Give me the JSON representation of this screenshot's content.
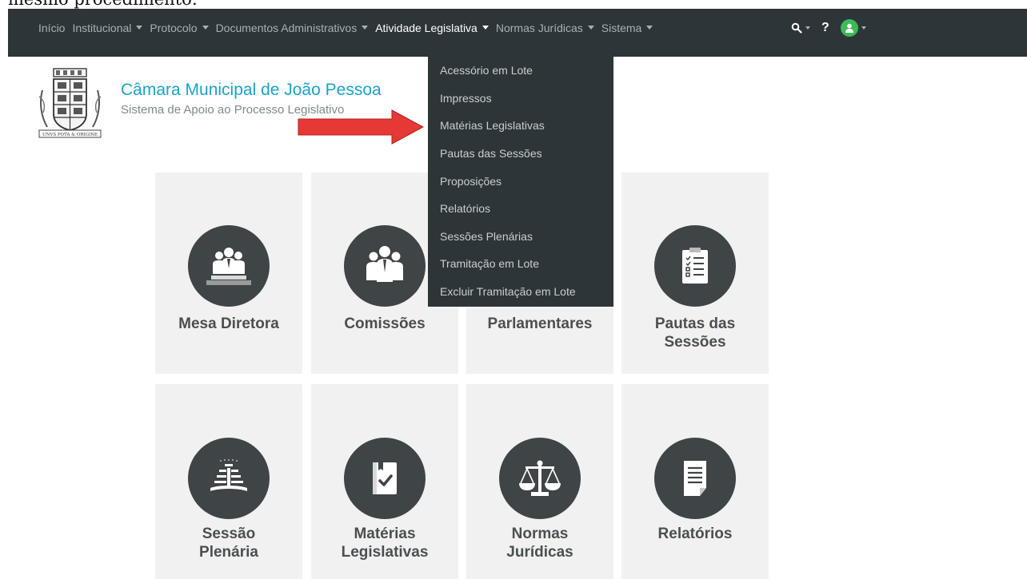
{
  "caption": "mesmo procedimento:",
  "navbar": {
    "items": [
      {
        "label": "Início",
        "caret": false,
        "active": false
      },
      {
        "label": "Institucional",
        "caret": true,
        "active": false
      },
      {
        "label": "Protocolo",
        "caret": true,
        "active": false
      },
      {
        "label": "Documentos Administrativos",
        "caret": true,
        "active": false
      },
      {
        "label": "Atividade Legislativa",
        "caret": true,
        "active": true
      },
      {
        "label": "Normas Jurídicas",
        "caret": true,
        "active": false
      },
      {
        "label": "Sistema",
        "caret": true,
        "active": false
      }
    ],
    "help_label": "?"
  },
  "dropdown": {
    "items": [
      "Acessório em Lote",
      "Impressos",
      "Matérias Legislativas",
      "Pautas das Sessões",
      "Proposições",
      "Relatórios",
      "Sessões Plenárias",
      "Tramitação em Lote",
      "Excluir Tramitação em Lote"
    ]
  },
  "header": {
    "title": "Câmara Municipal de João Pessoa",
    "subtitle": "Sistema de Apoio ao Processo Legislativo",
    "logo_motto": "UNVS POTA & ORIGINE"
  },
  "cards": [
    {
      "label_line1": "Mesa Diretora",
      "label_line2": "",
      "icon": "mesa-diretora-icon"
    },
    {
      "label_line1": "Comissões",
      "label_line2": "",
      "icon": "comissoes-icon"
    },
    {
      "label_line1": "Parlamentares",
      "label_line2": "",
      "icon": "parlamentares-icon"
    },
    {
      "label_line1": "Pautas das",
      "label_line2": "Sessões",
      "icon": "checklist-icon"
    },
    {
      "label_line1": "Sessão",
      "label_line2": "Plenária",
      "icon": "plenary-icon"
    },
    {
      "label_line1": "Matérias",
      "label_line2": "Legislativas",
      "icon": "book-check-icon"
    },
    {
      "label_line1": "Normas",
      "label_line2": "Jurídicas",
      "icon": "scales-icon"
    },
    {
      "label_line1": "Relatórios",
      "label_line2": "",
      "icon": "document-icon"
    }
  ],
  "colors": {
    "navbar_bg": "#2d3538",
    "title": "#1aa3c8",
    "arrow": "#e53935",
    "card_bg": "#f1f1f1",
    "icon_circle": "#3f4447",
    "avatar": "#3cba54"
  }
}
